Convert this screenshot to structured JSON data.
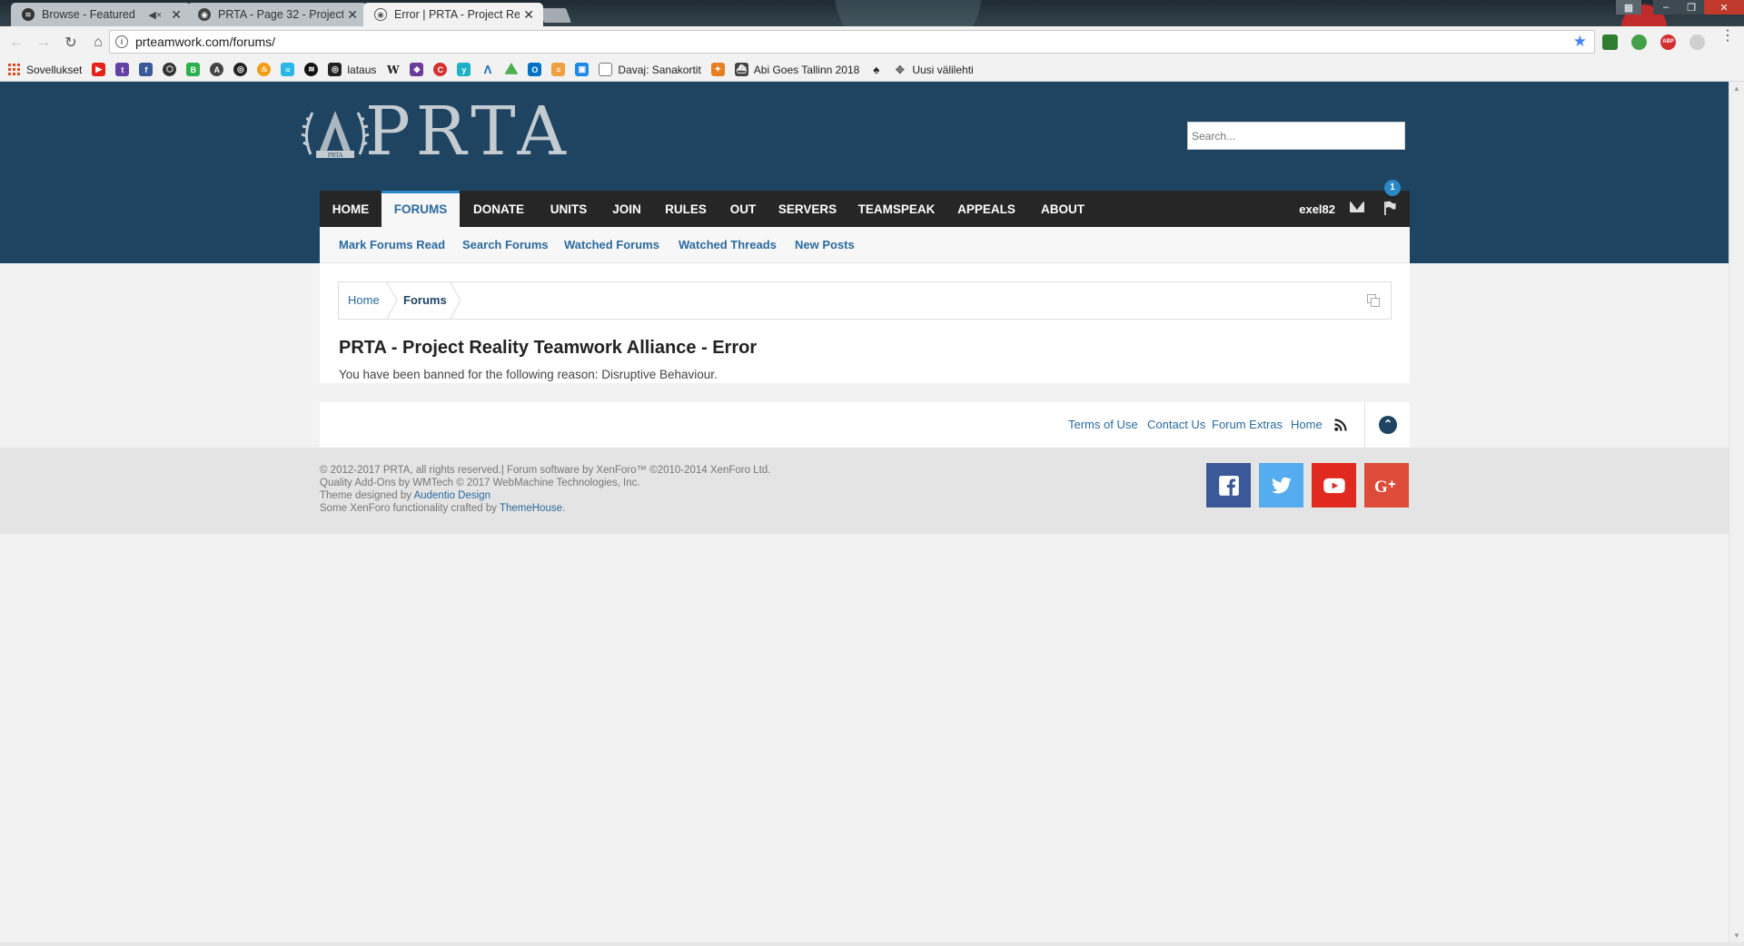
{
  "browser": {
    "tabs": [
      {
        "title": "Browse - Featured",
        "muted": true
      },
      {
        "title": "PRTA - Page 32 - Project",
        "muted": false
      },
      {
        "title": "Error | PRTA - Project Re",
        "muted": false
      }
    ],
    "url": "prteamwork.com/forums/",
    "bookmarks": [
      {
        "label": "Sovellukset",
        "icon": "apps-icon"
      },
      {
        "label": "",
        "icon": "youtube-icon",
        "color": "#e62117"
      },
      {
        "label": "",
        "icon": "twitch-icon",
        "color": "#6441a5"
      },
      {
        "label": "",
        "icon": "facebook-icon",
        "color": "#3b5998"
      },
      {
        "label": "",
        "icon": "hex-icon",
        "color": "#333333"
      },
      {
        "label": "",
        "icon": "b-icon",
        "color": "#2bb24c"
      },
      {
        "label": "",
        "icon": "circle-a-icon",
        "color": "#444444"
      },
      {
        "label": "",
        "icon": "steam-icon",
        "color": "#222222"
      },
      {
        "label": "",
        "icon": "fire-icon",
        "color": "#f39c12"
      },
      {
        "label": "",
        "icon": "wave-icon",
        "color": "#2ab7e5"
      },
      {
        "label": "",
        "icon": "spotify-icon",
        "color": "#111111"
      },
      {
        "label": "lataus",
        "icon": "steam-icon",
        "color": "#222222"
      },
      {
        "label": "",
        "icon": "wikipedia-icon",
        "color": "#222222"
      },
      {
        "label": "",
        "icon": "shield-icon",
        "color": "#6a3d9a"
      },
      {
        "label": "",
        "icon": "c-icon",
        "color": "#d63031"
      },
      {
        "label": "",
        "icon": "yle-icon",
        "color": "#1db0c9"
      },
      {
        "label": "",
        "icon": "lambda-icon",
        "color": "#1565c0"
      },
      {
        "label": "",
        "icon": "drive-icon",
        "color": "#4caf50"
      },
      {
        "label": "",
        "icon": "outlook-icon",
        "color": "#0072c6"
      },
      {
        "label": "",
        "icon": "page-icon",
        "color": "#f0a040"
      },
      {
        "label": "",
        "icon": "note-icon",
        "color": "#1e88e5"
      },
      {
        "label": "Davaj: Sanakortit",
        "icon": "doc-icon",
        "color": "#777777"
      },
      {
        "label": "",
        "icon": "ninja-icon",
        "color": "#e67e22"
      },
      {
        "label": "Abi Goes Tallinn 2018",
        "icon": "ship-icon",
        "color": "#444444"
      },
      {
        "label": "",
        "icon": "bird-icon",
        "color": "#222222"
      },
      {
        "label": "Uusi välilehti",
        "icon": "puzzle-icon",
        "color": "#666666"
      }
    ]
  },
  "site": {
    "logo_text": "PRTA",
    "search_placeholder": "Search...",
    "nav": {
      "items": [
        "HOME",
        "FORUMS",
        "DONATE",
        "UNITS",
        "JOIN",
        "RULES",
        "OUT",
        "SERVERS",
        "TEAMSPEAK",
        "APPEALS",
        "ABOUT"
      ],
      "active": "FORUMS",
      "username": "exel82",
      "alert_count": "1"
    },
    "subnav": [
      "Mark Forums Read",
      "Search Forums",
      "Watched Forums",
      "Watched Threads",
      "New Posts"
    ],
    "breadcrumb": [
      "Home",
      "Forums"
    ],
    "page_title": "PRTA - Project Reality Teamwork Alliance - Error",
    "error_message": "You have been banned for the following reason: Disruptive Behaviour.",
    "footer_links": [
      "Terms of Use",
      "Contact Us",
      "Forum Extras",
      "Home"
    ],
    "copyright": {
      "line1": "© 2012-2017 PRTA, all rights reserved.| Forum software by XenForo™ ©2010-2014 XenForo Ltd.",
      "line2": "Quality Add-Ons by WMTech © 2017 WebMachine Technologies, Inc.",
      "line3_prefix": "Theme designed by ",
      "line3_link": "Audentio Design",
      "line4_prefix": "Some XenForo functionality crafted by ",
      "line4_link": "ThemeHouse",
      "line4_suffix": "."
    },
    "social": [
      "facebook-icon",
      "twitter-icon",
      "youtube-icon",
      "google-plus-icon"
    ],
    "colors": {
      "header_bg": "#1f4462",
      "nav_bg": "#262626",
      "link": "#2a6a9e",
      "accent": "#2a87c8"
    }
  }
}
